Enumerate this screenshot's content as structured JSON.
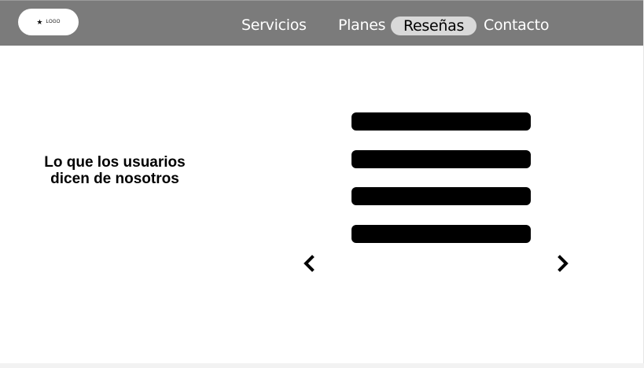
{
  "header": {
    "logo_text": "LOGO",
    "logo_icon": "star-icon",
    "nav": {
      "servicios": "Servicios",
      "planes": "Planes",
      "resenas": "Reseñas",
      "contacto": "Contacto"
    },
    "active_nav": "Reseñas"
  },
  "main": {
    "title_line1": "Lo que los usuarios",
    "title_line2": "dicen de nosotros",
    "reviews": [
      "",
      "",
      "",
      ""
    ],
    "prev_icon": "chevron-left-icon",
    "next_icon": "chevron-right-icon"
  },
  "colors": {
    "header_bg": "#7b7b7b",
    "active_pill_bg": "#d9d9d9",
    "review_bar": "#000000"
  }
}
